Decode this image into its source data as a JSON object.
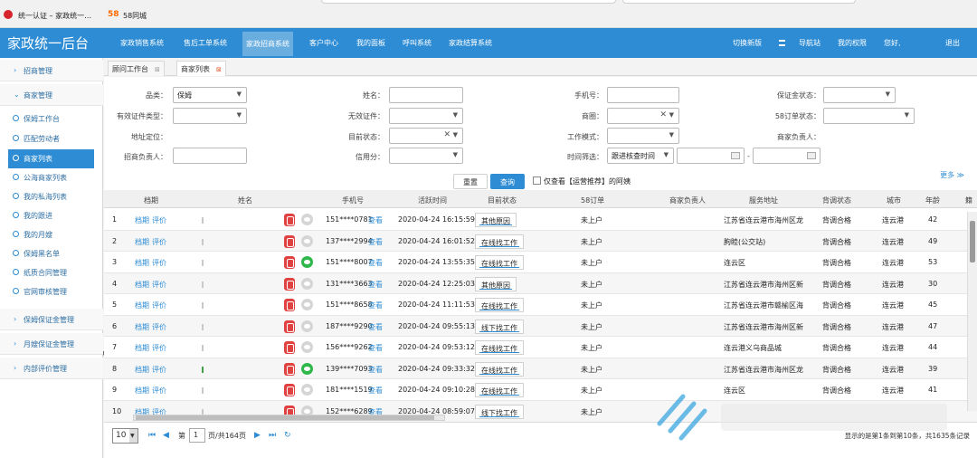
{
  "browser": {
    "tab_title": "统一认证 – 家政统一…",
    "tab2_logo": "58",
    "tab2_title": "58同城"
  },
  "topnav": {
    "brand": "家政统一后台",
    "items": [
      "家政销售系统",
      "售后工单系统",
      "家政招商系统",
      "客户中心",
      "我的面板",
      "呼叫系统",
      "家政结算系统"
    ],
    "active_index": 2,
    "right_items": [
      "切换新版",
      "导航站",
      "我的权限",
      "您好,",
      "退出"
    ]
  },
  "sidebar": {
    "groups": [
      {
        "label": "招商管理",
        "expanded": false
      },
      {
        "label": "商家管理",
        "expanded": true
      },
      {
        "label": "保姆保证金管理",
        "expanded": false
      },
      {
        "label": "月嫂保证金管理",
        "expanded": false
      },
      {
        "label": "内部评价管理",
        "expanded": false
      }
    ],
    "items": [
      "保姆工作台",
      "匹配劳动者",
      "商家列表",
      "公海商家列表",
      "我的私海列表",
      "我的跟进",
      "我的月嫂",
      "保姆黑名单",
      "纸质合同管理",
      "官网审核管理"
    ],
    "active_index": 2,
    "collapse_glyph": "◀"
  },
  "page_tabs": [
    {
      "label": "顾问工作台"
    },
    {
      "label": "商家列表"
    }
  ],
  "filters": {
    "category_label": "品类：",
    "category_value": "保姆",
    "name_label": "姓名：",
    "phone_label": "手机号：",
    "deposit_label": "保证金状态：",
    "cert_type_label": "有效证件类型：",
    "invalid_cert_label": "无效证件：",
    "shop_label": "商圈：",
    "order58_label": "58订单状态：",
    "location_label": "地址定位：",
    "current_status_label": "目前状态：",
    "work_mode_label": "工作模式：",
    "merchant_owner_label": "商家负责人：",
    "recruiter_label": "招商负责人：",
    "credit_label": "信用分：",
    "time_filter_label": "时间筛选：",
    "time_filter_value": "跟进核查时间",
    "date_sep": "-",
    "reset": "重置",
    "query": "查询",
    "checkbox_label": "仅查看【运营推荐】的阿姨",
    "more": "更多"
  },
  "grid": {
    "columns": [
      "档期",
      "姓名",
      "手机号",
      "活跃时间",
      "目前状态",
      "58订单",
      "商家负责人",
      "服务地址",
      "背调状态",
      "城市",
      "年龄",
      "籍"
    ],
    "schedule_link": "档期",
    "eval_link": "评价",
    "view_link": "查看",
    "rows": [
      {
        "no": "1",
        "wx": false,
        "green": false,
        "phone": "151****0781",
        "active": "2020-04-24 16:15:59",
        "status": "其他原因",
        "order58": "未上户",
        "address": "江苏省连云港市海州区龙",
        "bg": "背调合格",
        "city": "连云港",
        "age": "42"
      },
      {
        "no": "2",
        "wx": false,
        "green": false,
        "phone": "137****2994",
        "active": "2020-04-24 16:01:52",
        "status": "在线找工作",
        "order58": "未上户",
        "address": "朐睦(公交站)",
        "bg": "背调合格",
        "city": "连云港",
        "age": "49"
      },
      {
        "no": "3",
        "wx": true,
        "green": false,
        "phone": "151****8007",
        "active": "2020-04-24 13:55:35",
        "status": "在线找工作",
        "order58": "未上户",
        "address": "连云区",
        "bg": "背调合格",
        "city": "连云港",
        "age": "53"
      },
      {
        "no": "4",
        "wx": false,
        "green": false,
        "phone": "131****3663",
        "active": "2020-04-24 12:25:03",
        "status": "其他原因",
        "order58": "未上户",
        "address": "江苏省连云港市海州区新",
        "bg": "背调合格",
        "city": "连云港",
        "age": "30"
      },
      {
        "no": "5",
        "wx": false,
        "green": false,
        "phone": "151****8658",
        "active": "2020-04-24 11:11:53",
        "status": "在线找工作",
        "order58": "未上户",
        "address": "江苏省连云港市赣榆区海",
        "bg": "背调合格",
        "city": "连云港",
        "age": "45"
      },
      {
        "no": "6",
        "wx": false,
        "green": false,
        "phone": "187****9290",
        "active": "2020-04-24 09:55:13",
        "status": "线下找工作",
        "order58": "未上户",
        "address": "江苏省连云港市海州区新",
        "bg": "背调合格",
        "city": "连云港",
        "age": "47"
      },
      {
        "no": "7",
        "wx": false,
        "green": false,
        "phone": "156****9262",
        "active": "2020-04-24 09:53:12",
        "status": "在线找工作",
        "order58": "未上户",
        "address": "连云港义乌商品城",
        "bg": "背调合格",
        "city": "连云港",
        "age": "44"
      },
      {
        "no": "8",
        "wx": true,
        "green": true,
        "phone": "139****7093",
        "active": "2020-04-24 09:33:32",
        "status": "在线找工作",
        "order58": "未上户",
        "address": "江苏省连云港市海州区龙",
        "bg": "背调合格",
        "city": "连云港",
        "age": "39"
      },
      {
        "no": "9",
        "wx": false,
        "green": false,
        "phone": "181****1519",
        "active": "2020-04-24 09:10:28",
        "status": "在线找工作",
        "order58": "未上户",
        "address": "连云区",
        "bg": "背调合格",
        "city": "连云港",
        "age": "41"
      },
      {
        "no": "10",
        "wx": false,
        "green": false,
        "phone": "152****6289",
        "active": "2020-04-24 08:59:07",
        "status": "线下找工作",
        "order58": "未上户",
        "address": "",
        "bg": "",
        "city": "",
        "age": ""
      }
    ]
  },
  "pager": {
    "page_size": "10",
    "page_prefix": "第",
    "page_value": "1",
    "page_suffix": "页/共164页",
    "summary": "显示的是第1条到第10条，共1635条记录"
  }
}
